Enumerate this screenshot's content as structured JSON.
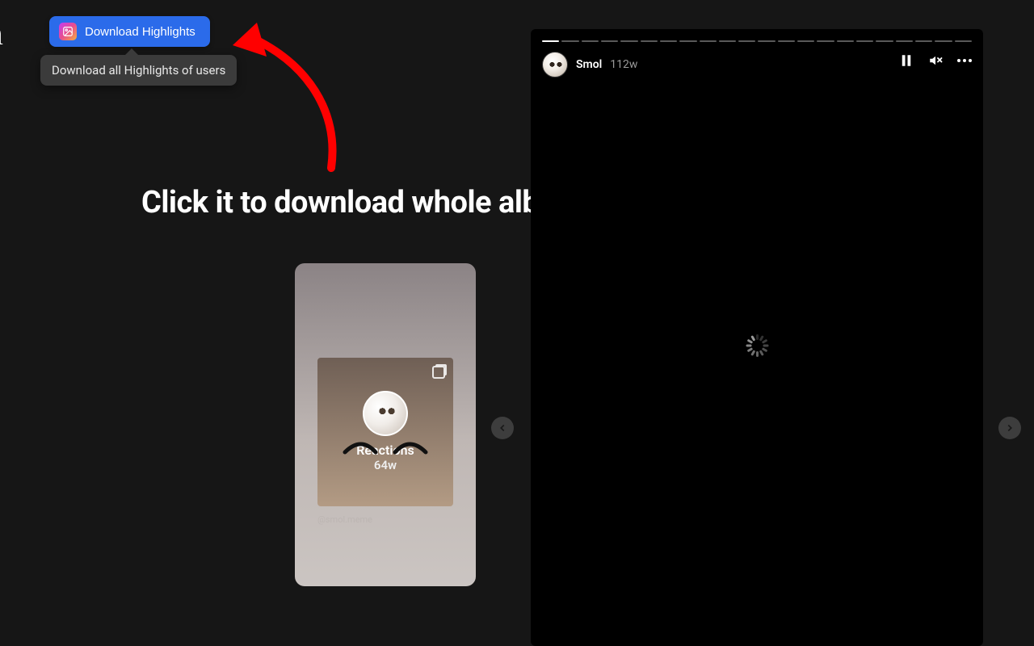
{
  "logo_fragment": "am",
  "download_button": {
    "label": "Download Highlights",
    "tooltip": "Download all Highlights of users"
  },
  "instruction_text": "Click it to download whole album",
  "preview_card": {
    "title": "Reactions",
    "age": "64w",
    "attribution": "@smol.meme"
  },
  "story": {
    "username": "Smol",
    "age": "112w",
    "segment_count": 22,
    "active_segment_index": 0
  }
}
